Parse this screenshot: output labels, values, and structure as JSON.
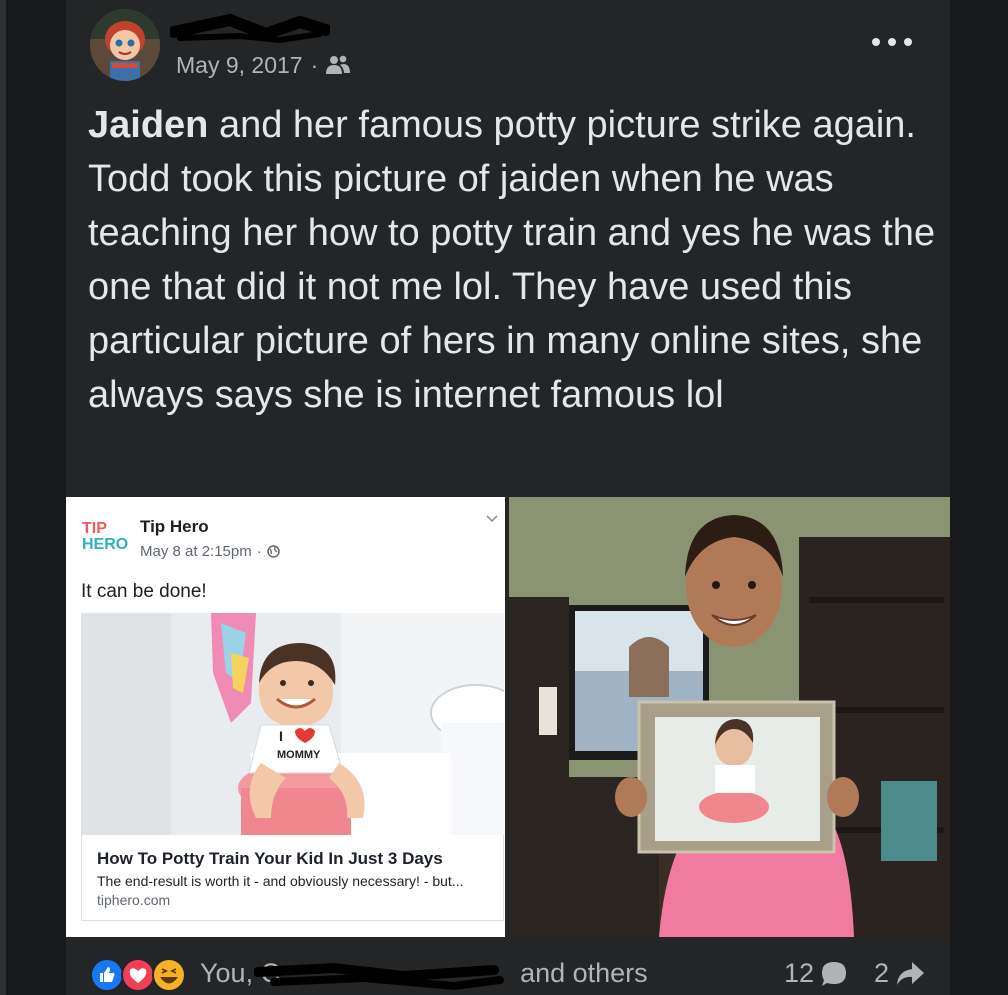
{
  "post": {
    "date": "May 9, 2017",
    "separator": "·",
    "audience_icon": "friends-icon",
    "text_bold": "Jaiden",
    "text_rest": " and her famous potty picture strike again. Todd took this picture of jaiden when he was teaching her how to potty train and yes he was the one that did it not me lol. They have used this particular picture of hers in many online sites, she always says she is internet famous lol"
  },
  "shared_screenshot": {
    "logo_line1": "TIP",
    "logo_line2": "HERO",
    "page_name": "Tip Hero",
    "time": "May 8 at 2:15pm",
    "dot": "·",
    "caption": "It can be done!",
    "image_shirt_text": "I ♥ MOMMY",
    "link_title": "How To Potty Train Your Kid In Just 3 Days",
    "link_description": "The end-result is worth it - and obviously necessary! - but...",
    "link_domain": "tiphero.com"
  },
  "footer": {
    "reactions_text_start": "You, C",
    "reactions_text_end": "and others",
    "reaction_icons": [
      "like-icon",
      "love-icon",
      "haha-icon"
    ],
    "comment_count": "12",
    "share_count": "2"
  },
  "colors": {
    "background": "#18191a",
    "card": "#242526",
    "text_primary": "#e4e6eb",
    "text_secondary": "#b0b3b8",
    "like_blue": "#1877f2",
    "love_red": "#f33e58",
    "haha_yellow": "#f7b125",
    "tiphero_red": "#f05a5a",
    "tiphero_teal": "#2bb3c0"
  }
}
